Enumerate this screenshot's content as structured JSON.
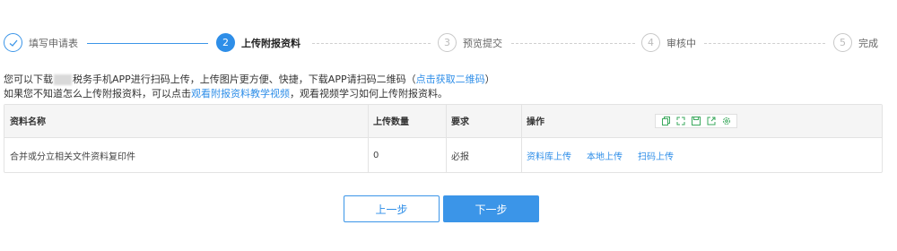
{
  "steps": [
    {
      "number": "✓",
      "label": "填写申请表",
      "state": "done"
    },
    {
      "number": "2",
      "label": "上传附报资料",
      "state": "active"
    },
    {
      "number": "3",
      "label": "预览提交",
      "state": "pending"
    },
    {
      "number": "4",
      "label": "审核中",
      "state": "pending"
    },
    {
      "number": "5",
      "label": "完成",
      "state": "pending"
    }
  ],
  "hints": {
    "line1_part1": "您可以下载",
    "line1_part2": "税务手机APP进行扫码上传，上传图片更方便、快捷，下载APP请扫码二维码（",
    "line1_link": "点击获取二维码",
    "line1_part3": "）",
    "line2_part1": "如果您不知道怎么上传附报资料，可以点击",
    "line2_link": "观看附报资料教学视频",
    "line2_part2": "，观看视频学习如何上传附报资料。"
  },
  "table": {
    "headers": {
      "name": "资料名称",
      "count": "上传数量",
      "requirement": "要求",
      "operation": "操作"
    },
    "rows": [
      {
        "name": "合并或分立相关文件资料复印件",
        "count": "0",
        "requirement": "必报",
        "ops": [
          "资料库上传",
          "本地上传",
          "扫码上传"
        ]
      }
    ],
    "toolbar_icons": [
      "copy-icon",
      "expand-icon",
      "save-icon",
      "export-icon",
      "settings-icon"
    ]
  },
  "buttons": {
    "prev": "上一步",
    "next": "下一步"
  },
  "colors": {
    "accent": "#2e8ee8",
    "toolbar_icon": "#3aa85c"
  }
}
